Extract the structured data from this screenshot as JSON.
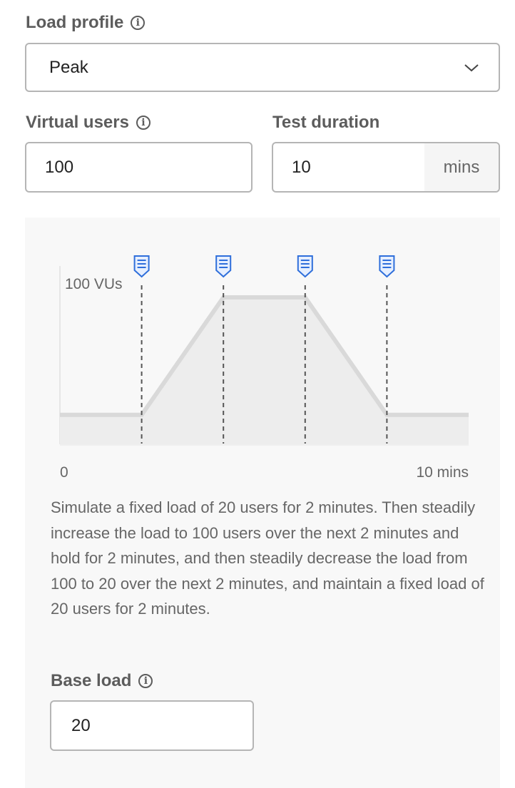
{
  "load_profile": {
    "label": "Load profile",
    "value": "Peak"
  },
  "virtual_users": {
    "label": "Virtual users",
    "value": "100"
  },
  "test_duration": {
    "label": "Test duration",
    "value": "10",
    "unit": "mins"
  },
  "chart_data": {
    "type": "area",
    "x": [
      0,
      2,
      4,
      6,
      8,
      10
    ],
    "values": [
      20,
      20,
      100,
      100,
      20,
      20
    ],
    "xlim": [
      0,
      10
    ],
    "ylim": [
      0,
      100
    ],
    "y_label": "100 VUs",
    "x_tick_labels": [
      "0",
      "10 mins"
    ],
    "markers_x": [
      2,
      4,
      6,
      8
    ],
    "marker_color": "#2f6fdb",
    "fill_color": "#ededed",
    "line_color": "#d8d8d8"
  },
  "description": "Simulate a fixed load of 20 users for 2 minutes. Then steadily increase the load to 100 users over the next 2 minutes and hold for 2 minutes, and then steadily decrease the load from 100 to 20 over the next 2 minutes, and maintain a fixed load of 20 users for 2 minutes.",
  "base_load": {
    "label": "Base load",
    "value": "20"
  }
}
